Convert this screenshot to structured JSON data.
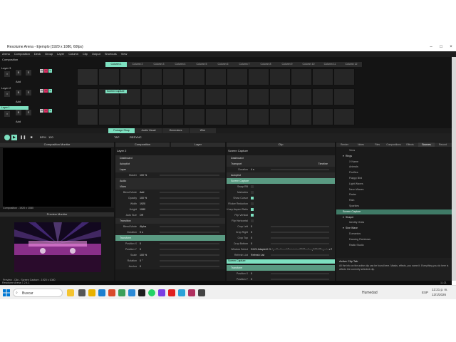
{
  "window": {
    "title": "Resolume Arena - Ejemplo (1920 x 1080, 60fps)"
  },
  "menu": [
    "Arena",
    "Composition",
    "Deck",
    "Group",
    "Layer",
    "Column",
    "Clip",
    "Output",
    "Shortcuts",
    "View"
  ],
  "composition": {
    "label": "Composition",
    "columns": [
      "Column 1",
      "Column 2",
      "Column 3",
      "Column 4",
      "Column 5",
      "Column 6",
      "Column 7",
      "Column 8",
      "Column 9",
      "Column 10",
      "Column 11",
      "Column 12"
    ],
    "active_column": 0,
    "layers": [
      {
        "name": "Layer 3",
        "add": "Add",
        "clip": ""
      },
      {
        "name": "Layer 2",
        "add": "Add",
        "clip": "Screen Capture"
      },
      {
        "name": "Layer 1",
        "add": "Add",
        "clip": ""
      }
    ],
    "decks": [
      "Footage Shop",
      "Audio Visual",
      "Generators",
      "Wire"
    ],
    "bpm_label": "BPM",
    "bpm_value": "120",
    "tempo_buttons": [
      "TAP",
      "RESYNC"
    ]
  },
  "composition_monitor": {
    "title": "Composition Monitor",
    "footer": "Composition - 1920 x 1080"
  },
  "preview_monitor": {
    "title": "Preview Monitor",
    "footer": "Preview - Clip - Screen Capture - 1920 x 1080"
  },
  "tabs_top": {
    "composition": "Composition",
    "layer": "Layer",
    "clip": "Clip"
  },
  "layer_panel": {
    "name": "Layer 2",
    "rows": [
      {
        "label": "Dashboard",
        "type": "sec"
      },
      {
        "label": "Autopilot",
        "type": "sec"
      },
      {
        "label": "Layer",
        "type": "sec"
      },
      {
        "label": "Master",
        "value": "100 %",
        "type": "param"
      },
      {
        "label": "Audio",
        "type": "sec"
      },
      {
        "label": "Video",
        "type": "sec"
      },
      {
        "label": "Blend Mode",
        "value": "Add",
        "type": "param"
      },
      {
        "label": "Opacity",
        "value": "100 %",
        "type": "param"
      },
      {
        "label": "Width",
        "value": "1920",
        "type": "param"
      },
      {
        "label": "Height",
        "value": "1080",
        "type": "param"
      },
      {
        "label": "Auto Size",
        "value": "Off",
        "type": "param"
      },
      {
        "label": "Transition",
        "type": "sec"
      },
      {
        "label": "Blend Mode",
        "value": "Alpha",
        "type": "param"
      },
      {
        "label": "Duration",
        "value": "0 s",
        "type": "param"
      },
      {
        "label": "Transform",
        "type": "hl"
      },
      {
        "label": "Position X",
        "value": "0",
        "type": "param"
      },
      {
        "label": "Position Y",
        "value": "0",
        "type": "param"
      },
      {
        "label": "Scale",
        "value": "100 %",
        "type": "param"
      },
      {
        "label": "Rotation",
        "value": "0 °",
        "type": "param"
      },
      {
        "label": "Anchor",
        "value": "0",
        "type": "param"
      }
    ]
  },
  "clip_panel": {
    "name": "Screen Capture",
    "rows": [
      {
        "label": "Dashboard",
        "type": "sec"
      },
      {
        "label": "Transport",
        "type": "sec",
        "value": "Timeline"
      },
      {
        "label": "Duration",
        "value": "4 s",
        "type": "param"
      },
      {
        "label": "Autopilot",
        "type": "sec"
      },
      {
        "label": "Screen Capture",
        "type": "hl"
      },
      {
        "label": "Swap RB",
        "type": "check",
        "on": false
      },
      {
        "label": "Mainview",
        "type": "check",
        "on": false
      },
      {
        "label": "Show Cursor",
        "type": "check",
        "on": true
      },
      {
        "label": "Flicker Reduction",
        "type": "check",
        "on": false
      },
      {
        "label": "Keep Aspect Ratio",
        "type": "check",
        "on": true
      },
      {
        "label": "Flip Vertical",
        "type": "check",
        "on": true
      },
      {
        "label": "Flip Horizontal",
        "type": "check",
        "on": false
      },
      {
        "label": "Crop Left",
        "value": "0",
        "type": "param"
      },
      {
        "label": "Crop Right",
        "value": "0",
        "type": "param"
      },
      {
        "label": "Crop Top",
        "value": "0",
        "type": "param"
      },
      {
        "label": "Crop Bottom",
        "value": "0",
        "type": "param"
      },
      {
        "label": "Window Select",
        "value": "DXGI Adapter0 Output0 - Live 4 Tutoriales 2020 - Jerry2024/Reportes R0 1080p HUD HD",
        "type": "param"
      },
      {
        "label": "Refresh List",
        "value": "Refresh List",
        "type": "param"
      }
    ],
    "effect_clip": "Screen Capture",
    "transform_rows": [
      {
        "label": "Transform",
        "type": "hl"
      },
      {
        "label": "Position X",
        "value": "0",
        "type": "param"
      },
      {
        "label": "Position Y",
        "value": "0",
        "type": "param"
      }
    ]
  },
  "sources_panel": {
    "tabs": [
      "Render",
      "Notes",
      "Files",
      "Compositions",
      "Effects",
      "Sources",
      "Record"
    ],
    "active_tab": "Sources",
    "items": [
      {
        "text": "Virus",
        "indent": 2
      },
      {
        "text": "Rings",
        "indent": 1,
        "folder": true
      },
      {
        "text": "X Name",
        "indent": 2
      },
      {
        "text": "Animals",
        "indent": 2
      },
      {
        "text": "Fireflies",
        "indent": 2
      },
      {
        "text": "Flappy Bird",
        "indent": 2
      },
      {
        "text": "Light Waves",
        "indent": 2
      },
      {
        "text": "Neon Waves",
        "indent": 2
      },
      {
        "text": "Radar",
        "indent": 2
      },
      {
        "text": "Rain",
        "indent": 2
      },
      {
        "text": "Sparkles",
        "indent": 2
      },
      {
        "text": "Screen Capture",
        "indent": 1,
        "selected": true
      },
      {
        "text": "Shaper",
        "indent": 1,
        "folder": true
      },
      {
        "text": "Identity Grids",
        "indent": 2
      },
      {
        "text": "Sine Wave",
        "indent": 1,
        "folder": true
      },
      {
        "text": "Dumanios",
        "indent": 2
      },
      {
        "text": "Dancing Rainbows",
        "indent": 2
      },
      {
        "text": "Radio Studio",
        "indent": 2
      }
    ],
    "info_title": "Active Clip Tab",
    "info_text": "All the info on the active clip can be found here. Masks, effects, you name it. Everything you do here is affects the currently selected clip."
  },
  "statusbar": {
    "left": "Resolume Arena 7.2.4.1",
    "right": "11:21"
  },
  "taskbar": {
    "search": "Buscar",
    "weather": "Humedad",
    "time": "12:21 p. m.",
    "date": "12/1/2026",
    "lang": "ESP"
  },
  "colors": {
    "accent": "#7de0c0",
    "panel": "#1a1a1a",
    "bg": "#141414"
  }
}
